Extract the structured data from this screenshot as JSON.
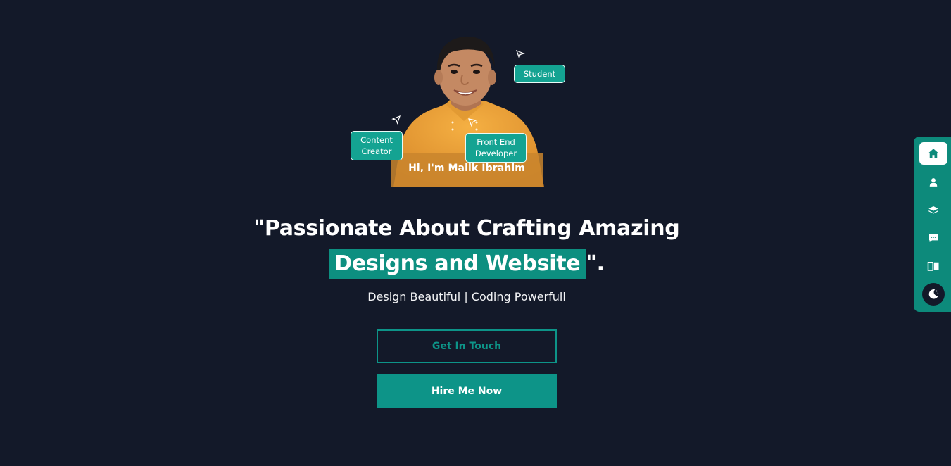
{
  "hero": {
    "greeting": "Hi, I'm Malik Ibrahim",
    "tags": {
      "student": "Student",
      "content_creator": "Content Creator",
      "front_end_developer": "Front End Developer"
    },
    "headline_part1": "\"Passionate About Crafting Amazing",
    "headline_highlight": "Designs and Website",
    "headline_end": "\".",
    "subtitle": "Design Beautiful | Coding Powerfull"
  },
  "buttons": {
    "get_in_touch": "Get In Touch",
    "hire_me": "Hire Me Now"
  },
  "sidenav": {
    "items": [
      {
        "icon": "home-icon",
        "active": true
      },
      {
        "icon": "user-icon",
        "active": false
      },
      {
        "icon": "layers-icon",
        "active": false
      },
      {
        "icon": "chat-icon",
        "active": false
      },
      {
        "icon": "book-icon",
        "active": false
      }
    ],
    "theme_toggle_icon": "moon-icon"
  },
  "colors": {
    "background": "#131929",
    "accent": "#0d9488",
    "highlight": "#0d8f80",
    "tag": "#14a392",
    "shirt": "#f0a434"
  }
}
